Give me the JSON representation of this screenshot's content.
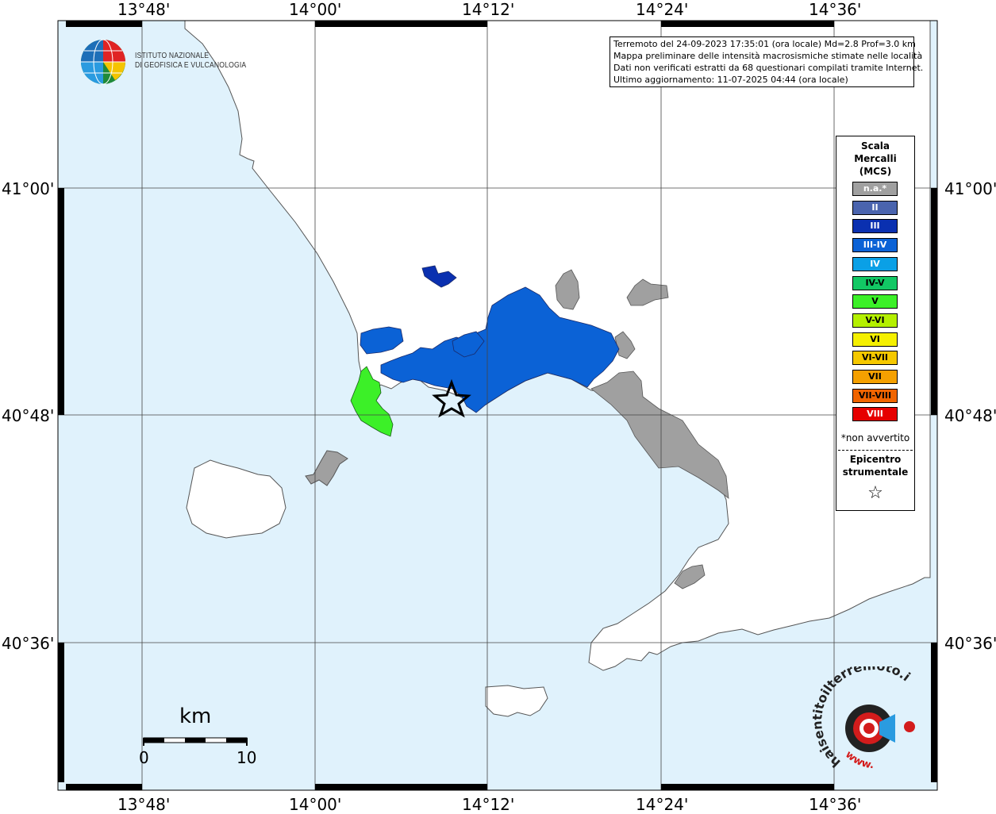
{
  "map": {
    "top_ticks": [
      "13°48'",
      "14°00'",
      "14°12'",
      "14°24'",
      "14°36'"
    ],
    "bottom_ticks": [
      "13°48'",
      "14°00'",
      "14°12'",
      "14°24'",
      "14°36'"
    ],
    "left_ticks": [
      "41°00'",
      "40°48'",
      "40°36'"
    ],
    "right_ticks": [
      "41°00'",
      "40°48'",
      "40°36'"
    ],
    "sea_color": "#e0f2fc",
    "land_color": "#ffffff",
    "na_color": "#a0a0a0"
  },
  "institute": {
    "line1": "ISTITUTO NAZIONALE",
    "line2": "DI GEOFISICA E VULCANOLOGIA"
  },
  "info": {
    "line1": "Terremoto del 24-09-2023 17:35:01 (ora locale) Md=2.8 Prof=3.0 km",
    "line2": "Mappa preliminare delle intensità macrosismiche stimate nelle località",
    "line3": "Dati non verificati estratti da 68 questionari compilati tramite Internet.",
    "line4": "Ultimo aggiornamento: 11-07-2025 04:44 (ora locale)"
  },
  "legend": {
    "title1": "Scala",
    "title2": "Mercalli",
    "title3": "(MCS)",
    "items": [
      {
        "label": "n.a.*",
        "color": "#a0a0a0",
        "text_color": "#ffffff"
      },
      {
        "label": "II",
        "color": "#4a64ae",
        "text_color": "#ffffff"
      },
      {
        "label": "III",
        "color": "#0a30b0",
        "text_color": "#ffffff"
      },
      {
        "label": "III-IV",
        "color": "#0b62d6",
        "text_color": "#ffffff"
      },
      {
        "label": "IV",
        "color": "#0aa0e6",
        "text_color": "#ffffff"
      },
      {
        "label": "IV-V",
        "color": "#12c864",
        "text_color": "#000000"
      },
      {
        "label": "V",
        "color": "#3cf028",
        "text_color": "#000000"
      },
      {
        "label": "V-VI",
        "color": "#b4f000",
        "text_color": "#000000"
      },
      {
        "label": "VI",
        "color": "#f5f000",
        "text_color": "#000000"
      },
      {
        "label": "VI-VII",
        "color": "#f5c800",
        "text_color": "#000000"
      },
      {
        "label": "VII",
        "color": "#f5a000",
        "text_color": "#000000"
      },
      {
        "label": "VII-VIII",
        "color": "#f06400",
        "text_color": "#000000"
      },
      {
        "label": "VIII",
        "color": "#e60000",
        "text_color": "#ffffff"
      }
    ],
    "note": "*non avvertito",
    "epicenter1": "Epicentro",
    "epicenter2": "strumentale",
    "epicenter_symbol": "☆"
  },
  "scale_bar": {
    "unit": "km",
    "start": "0",
    "end": "10"
  },
  "badge": {
    "text": "haisentitoilterremoto.it",
    "url_text": "www.",
    "icon": "seismic-target-icon"
  }
}
